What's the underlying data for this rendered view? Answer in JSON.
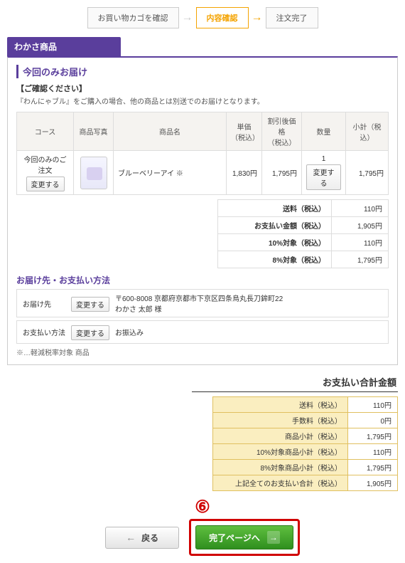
{
  "steps": {
    "s1": "お買い物カゴを確認",
    "s2": "内容確認",
    "s3": "注文完了"
  },
  "section": {
    "title": "わかさ商品"
  },
  "delivery": {
    "title": "今回のみお届け",
    "note_head": "【ご確認ください】",
    "note_body": "『わんにゃブル』をご購入の場合、他の商品とは別送でのお届けとなります。"
  },
  "headers": {
    "course": "コース",
    "photo": "商品写真",
    "name": "商品名",
    "unit": "単価\n（税込）",
    "disc": "割引後価格\n（税込）",
    "qty": "数量",
    "subtotal": "小計（税込）"
  },
  "row": {
    "course": "今回のみのご注文",
    "change": "変更する",
    "name": "ブルーベリーアイ ※",
    "unit": "1,830円",
    "disc": "1,795円",
    "qty": "1",
    "subtotal": "1,795円"
  },
  "totals": [
    {
      "label": "送料（税込）",
      "value": "110円"
    },
    {
      "label": "お支払い金額（税込）",
      "value": "1,905円"
    },
    {
      "label": "10%対象（税込）",
      "value": "110円"
    },
    {
      "label": "8%対象（税込）",
      "value": "1,795円"
    }
  ],
  "ship": {
    "title": "お届け先・お支払い方法",
    "to_label": "お届け先",
    "to_value": "〒600-8008 京都府京都市下京区四条烏丸長刀鉾町22\nわかさ 太郎 様",
    "pay_label": "お支払い方法",
    "pay_value": "お振込み",
    "change": "変更する",
    "footnote": "※…軽減税率対象 商品"
  },
  "pay_section": {
    "title": "お支払い合計金額",
    "rows": [
      {
        "label": "送料（税込）",
        "value": "110円"
      },
      {
        "label": "手数料（税込）",
        "value": "0円"
      },
      {
        "label": "商品小計（税込）",
        "value": "1,795円"
      },
      {
        "label": "10%対象商品小計（税込）",
        "value": "110円"
      },
      {
        "label": "8%対象商品小計（税込）",
        "value": "1,795円"
      },
      {
        "label": "上記全てのお支払い合計（税込）",
        "value": "1,905円"
      }
    ]
  },
  "annotation": "⑥",
  "buttons": {
    "back": "戻る",
    "next": "完了ページへ"
  }
}
